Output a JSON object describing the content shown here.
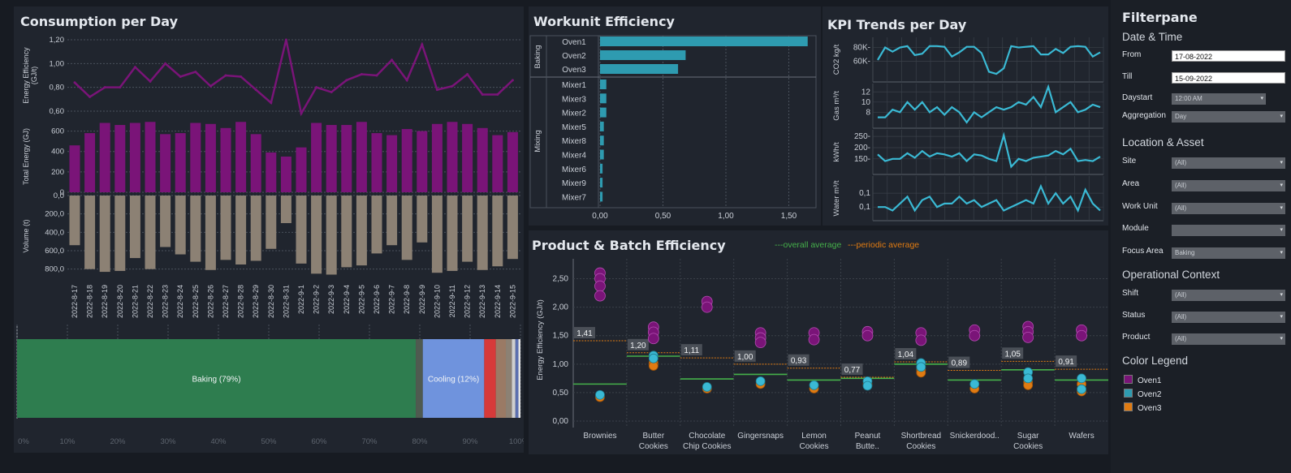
{
  "colors": {
    "purple": "#7a1478",
    "tan": "#8c8174",
    "teal": "#2e9bb0",
    "kpi": "#3ab9d4",
    "green": "#2e7d4f",
    "blue": "#6f93dd",
    "red": "#d63a3a",
    "orange": "#e07b12",
    "avg_green": "#45b04a",
    "avg_orange": "#e07b12"
  },
  "consumption": {
    "title": "Consumption per Day",
    "dates": [
      "2022-8-17",
      "2022-8-18",
      "2022-8-19",
      "2022-8-20",
      "2022-8-21",
      "2022-8-22",
      "2022-8-23",
      "2022-8-24",
      "2022-8-25",
      "2022-8-26",
      "2022-8-27",
      "2022-8-28",
      "2022-8-29",
      "2022-8-30",
      "2022-8-31",
      "2022-9-1",
      "2022-9-2",
      "2022-9-3",
      "2022-9-4",
      "2022-9-5",
      "2022-9-6",
      "2022-9-7",
      "2022-9-8",
      "2022-9-9",
      "2022-9-10",
      "2022-9-11",
      "2022-9-12",
      "2022-9-13",
      "2022-9-14",
      "2022-9-15"
    ],
    "efficiency": {
      "ylabel": "Energy Efficiency (GJ/t)",
      "ticks": [
        "1,20",
        "1,00",
        "0,80",
        "0,60"
      ],
      "ylim": [
        0.6,
        1.2
      ],
      "values": [
        0.84,
        0.72,
        0.8,
        0.8,
        0.97,
        0.85,
        1.0,
        0.89,
        0.93,
        0.81,
        0.9,
        0.89,
        0.78,
        0.67,
        1.2,
        0.58,
        0.8,
        0.76,
        0.86,
        0.91,
        0.9,
        1.03,
        0.86,
        1.16,
        0.78,
        0.81,
        0.91,
        0.74,
        0.74,
        0.86
      ]
    },
    "energy": {
      "ylabel": "Total Energy (GJ)",
      "ticks": [
        "600",
        "400",
        "200",
        "0"
      ],
      "ylim": [
        0,
        700
      ],
      "values": [
        460,
        580,
        680,
        660,
        680,
        690,
        570,
        580,
        680,
        670,
        630,
        690,
        570,
        390,
        350,
        440,
        680,
        660,
        660,
        690,
        580,
        560,
        620,
        600,
        670,
        690,
        670,
        630,
        560,
        590
      ]
    },
    "volume": {
      "ylabel": "Volume (t)",
      "ticks": [
        "0,0",
        "200,0",
        "400,0",
        "600,0",
        "800,0"
      ],
      "ylim": [
        0,
        900
      ],
      "values": [
        540,
        800,
        830,
        820,
        680,
        800,
        560,
        640,
        720,
        810,
        700,
        750,
        710,
        580,
        300,
        740,
        850,
        860,
        780,
        760,
        630,
        540,
        700,
        510,
        840,
        820,
        720,
        810,
        770,
        690
      ]
    }
  },
  "share": {
    "ticks": [
      "0%",
      "10%",
      "20%",
      "30%",
      "40%",
      "50%",
      "60%",
      "70%",
      "80%",
      "90%",
      "100%"
    ],
    "segments": [
      {
        "label": "Baking (79%)",
        "value": 79.2,
        "color": "#2e7d4f"
      },
      {
        "label": "",
        "value": 1.4,
        "color": "#4f5a50"
      },
      {
        "label": "Cooling (12%)",
        "value": 12.2,
        "color": "#6f93dd"
      },
      {
        "label": "",
        "value": 2.3,
        "color": "#d63a3a"
      },
      {
        "label": "",
        "value": 2.0,
        "color": "#9a7a65"
      },
      {
        "label": "",
        "value": 1.2,
        "color": "#8c8174"
      },
      {
        "label": "",
        "value": 0.7,
        "color": "#cfcfcf"
      },
      {
        "label": "",
        "value": 0.6,
        "color": "#5b6fb0"
      },
      {
        "label": "",
        "value": 0.4,
        "color": "#e6e6e6"
      }
    ]
  },
  "workunit": {
    "title": "Workunit Efficiency",
    "groups": [
      "Baking",
      "Mixing"
    ],
    "items": [
      {
        "name": "Oven1",
        "value": 1.65,
        "group": "Baking"
      },
      {
        "name": "Oven2",
        "value": 0.68,
        "group": "Baking"
      },
      {
        "name": "Oven3",
        "value": 0.62,
        "group": "Baking"
      },
      {
        "name": "Mixer1",
        "value": 0.05,
        "group": "Mixing"
      },
      {
        "name": "Mixer3",
        "value": 0.05,
        "group": "Mixing"
      },
      {
        "name": "Mixer2",
        "value": 0.05,
        "group": "Mixing"
      },
      {
        "name": "Mixer5",
        "value": 0.03,
        "group": "Mixing"
      },
      {
        "name": "Mixer8",
        "value": 0.03,
        "group": "Mixing"
      },
      {
        "name": "Mixer4",
        "value": 0.03,
        "group": "Mixing"
      },
      {
        "name": "Mixer6",
        "value": 0.02,
        "group": "Mixing"
      },
      {
        "name": "Mixer9",
        "value": 0.02,
        "group": "Mixing"
      },
      {
        "name": "Mixer7",
        "value": 0.02,
        "group": "Mixing"
      }
    ],
    "ticks": [
      "0,00",
      "0,50",
      "1,00",
      "1,50"
    ]
  },
  "kpi": {
    "title": "KPI Trends per Day",
    "rows": [
      {
        "ylabel": "CO2 kg/t",
        "ticks": [
          "80K",
          "60K"
        ],
        "tickvals": [
          80,
          60
        ],
        "ylim": [
          35,
          90
        ],
        "values": [
          62,
          80,
          74,
          80,
          82,
          69,
          71,
          82,
          82,
          81,
          67,
          73,
          81,
          81,
          72,
          45,
          42,
          50,
          82,
          80,
          81,
          82,
          70,
          70,
          78,
          72,
          81,
          82,
          81,
          67,
          73
        ]
      },
      {
        "ylabel": "Gas m³/t",
        "ticks": [
          "12",
          "10",
          "8"
        ],
        "tickvals": [
          12,
          10,
          8
        ],
        "ylim": [
          5.5,
          13
        ],
        "values": [
          7,
          7,
          8.5,
          8,
          10,
          8.5,
          10,
          8,
          9,
          7.5,
          9,
          8,
          6,
          8,
          7,
          8,
          9,
          8.5,
          9,
          10,
          9.5,
          11,
          9,
          13,
          8,
          9,
          10,
          8,
          8.5,
          9.5,
          9
        ]
      },
      {
        "ylabel": "kWh/t",
        "ticks": [
          "250",
          "200",
          "150"
        ],
        "tickvals": [
          250,
          200,
          150
        ],
        "ylim": [
          95,
          265
        ],
        "values": [
          170,
          140,
          150,
          150,
          175,
          155,
          185,
          160,
          175,
          170,
          160,
          175,
          140,
          170,
          165,
          150,
          140,
          255,
          115,
          150,
          140,
          155,
          160,
          165,
          185,
          170,
          195,
          140,
          145,
          140,
          160
        ]
      },
      {
        "ylabel": "Water m³/t",
        "ticks": [
          "0,1",
          "0,1"
        ],
        "tickvals": [
          0.13,
          0.09
        ],
        "ylim": [
          0.06,
          0.17
        ],
        "values": [
          0.09,
          0.09,
          0.08,
          0.1,
          0.12,
          0.08,
          0.11,
          0.12,
          0.09,
          0.1,
          0.1,
          0.12,
          0.1,
          0.11,
          0.09,
          0.1,
          0.11,
          0.08,
          0.09,
          0.1,
          0.11,
          0.1,
          0.15,
          0.1,
          0.13,
          0.1,
          0.12,
          0.08,
          0.14,
          0.1,
          0.08
        ]
      }
    ]
  },
  "product": {
    "title": "Product & Batch Efficiency",
    "legend": {
      "overall": "---overall average",
      "periodic": "---periodic average"
    },
    "ylabel": "Energy Efficiency (GJ/t)",
    "ticks": [
      "2,50",
      "2,00",
      "1,50",
      "1,00",
      "0,50",
      "0,00"
    ],
    "tickvals": [
      2.5,
      2.0,
      1.5,
      1.0,
      0.5,
      0.0
    ],
    "ylim": [
      0,
      2.85
    ],
    "products": [
      {
        "name": "Brownies",
        "name2": "",
        "avg_label": "1,41",
        "periodic": 1.41,
        "overall": 0.65,
        "oven1": [
          2.6,
          2.5,
          2.37,
          2.2
        ],
        "oven2": [
          0.46
        ],
        "oven3": [
          0.42
        ]
      },
      {
        "name": "Butter",
        "name2": "Cookies",
        "avg_label": "1,20",
        "periodic": 1.2,
        "overall": 1.14,
        "oven1": [
          1.65,
          1.56,
          1.45
        ],
        "oven2": [
          1.15,
          1.1
        ],
        "oven3": [
          1.02,
          0.97
        ]
      },
      {
        "name": "Chocolate",
        "name2": "Chip Cookies",
        "avg_label": "1,11",
        "periodic": 1.11,
        "overall": 0.74,
        "oven1": [
          2.1,
          2.0
        ],
        "oven2": [
          0.6
        ],
        "oven3": [
          0.57
        ]
      },
      {
        "name": "Gingersnaps",
        "name2": "",
        "avg_label": "1,00",
        "periodic": 1.0,
        "overall": 0.82,
        "oven1": [
          1.55,
          1.46,
          1.38
        ],
        "oven2": [
          0.7
        ],
        "oven3": [
          0.65
        ]
      },
      {
        "name": "Lemon",
        "name2": "Cookies",
        "avg_label": "0,93",
        "periodic": 0.93,
        "overall": 0.72,
        "oven1": [
          1.55,
          1.43
        ],
        "oven2": [
          0.63
        ],
        "oven3": [
          0.57
        ]
      },
      {
        "name": "Peanut",
        "name2": "Butte..",
        "avg_label": "0,77",
        "periodic": 0.77,
        "overall": 0.75,
        "oven1": [
          1.57,
          1.5
        ],
        "oven2": [
          0.7,
          0.62
        ],
        "oven3": [
          0.65
        ]
      },
      {
        "name": "Shortbread",
        "name2": "Cookies",
        "avg_label": "1,04",
        "periodic": 1.04,
        "overall": 1.0,
        "oven1": [
          1.55,
          1.42
        ],
        "oven2": [
          1.02,
          0.95
        ],
        "oven3": [
          0.9,
          0.85
        ]
      },
      {
        "name": "Snickerdood..",
        "name2": "",
        "avg_label": "0,89",
        "periodic": 0.89,
        "overall": 0.72,
        "oven1": [
          1.6,
          1.5
        ],
        "oven2": [
          0.65
        ],
        "oven3": [
          0.57
        ]
      },
      {
        "name": "Sugar",
        "name2": "Cookies",
        "avg_label": "1,05",
        "periodic": 1.05,
        "overall": 0.9,
        "oven1": [
          1.66,
          1.57,
          1.47
        ],
        "oven2": [
          0.86,
          0.75
        ],
        "oven3": [
          0.68,
          0.63
        ]
      },
      {
        "name": "Wafers",
        "name2": "",
        "avg_label": "0,91",
        "periodic": 0.91,
        "overall": 0.72,
        "oven1": [
          1.6,
          1.5
        ],
        "oven2": [
          0.75,
          0.56
        ],
        "oven3": [
          0.65,
          0.52
        ]
      }
    ]
  },
  "chart_data": [
    {
      "type": "line",
      "title": "Consumption per Day",
      "ylabel": "Energy Efficiency (GJ/t)",
      "ylim": [
        0.6,
        1.2
      ],
      "x": "consumption.dates",
      "series": [
        {
          "name": "Energy Efficiency",
          "values": "consumption.efficiency.values"
        }
      ]
    },
    {
      "type": "bar",
      "ylabel": "Total Energy (GJ)",
      "ylim": [
        0,
        700
      ],
      "categories": "consumption.dates",
      "values": "consumption.energy.values"
    },
    {
      "type": "bar",
      "ylabel": "Volume (t)",
      "ylim": [
        0,
        900
      ],
      "categories": "consumption.dates",
      "values": "consumption.volume.values"
    },
    {
      "type": "bar",
      "orientation": "horizontal-stacked-100%",
      "segments": "share.segments"
    },
    {
      "type": "bar",
      "orientation": "horizontal",
      "title": "Workunit Efficiency",
      "categories": "workunit.items",
      "xlim": [
        0,
        1.7
      ]
    },
    {
      "type": "line",
      "title": "KPI Trends per Day",
      "series": "kpi.rows"
    },
    {
      "type": "scatter",
      "title": "Product & Batch Efficiency",
      "ylabel": "Energy Efficiency (GJ/t)",
      "ylim": [
        0,
        2.85
      ],
      "categories": "product.products",
      "series": [
        {
          "name": "Oven1"
        },
        {
          "name": "Oven2"
        },
        {
          "name": "Oven3"
        }
      ]
    }
  ],
  "filterpane": {
    "title": "Filterpane",
    "date_section": "Date & Time",
    "from_label": "From",
    "from_value": "17-08-2022",
    "till_label": "Till",
    "till_value": "15-09-2022",
    "daystart_label": "Daystart",
    "daystart_value": "12:00 AM",
    "aggregation_label": "Aggregation",
    "aggregation_value": "Day",
    "location_section": "Location & Asset",
    "site_label": "Site",
    "site_value": "(All)",
    "area_label": "Area",
    "area_value": "(All)",
    "workunit_label": "Work Unit",
    "workunit_value": "(All)",
    "module_label": "Module",
    "module_value": "",
    "focus_label": "Focus Area",
    "focus_value": "Baking",
    "context_section": "Operational Context",
    "shift_label": "Shift",
    "shift_value": "(All)",
    "status_label": "Status",
    "status_value": "(All)",
    "product_label": "Product",
    "product_value": "(All)",
    "legend_section": "Color Legend",
    "legend": [
      {
        "label": "Oven1",
        "color": "#7a1478"
      },
      {
        "label": "Oven2",
        "color": "#2e9bb0"
      },
      {
        "label": "Oven3",
        "color": "#e07b12"
      }
    ],
    "dropdown_icon": "▾"
  }
}
